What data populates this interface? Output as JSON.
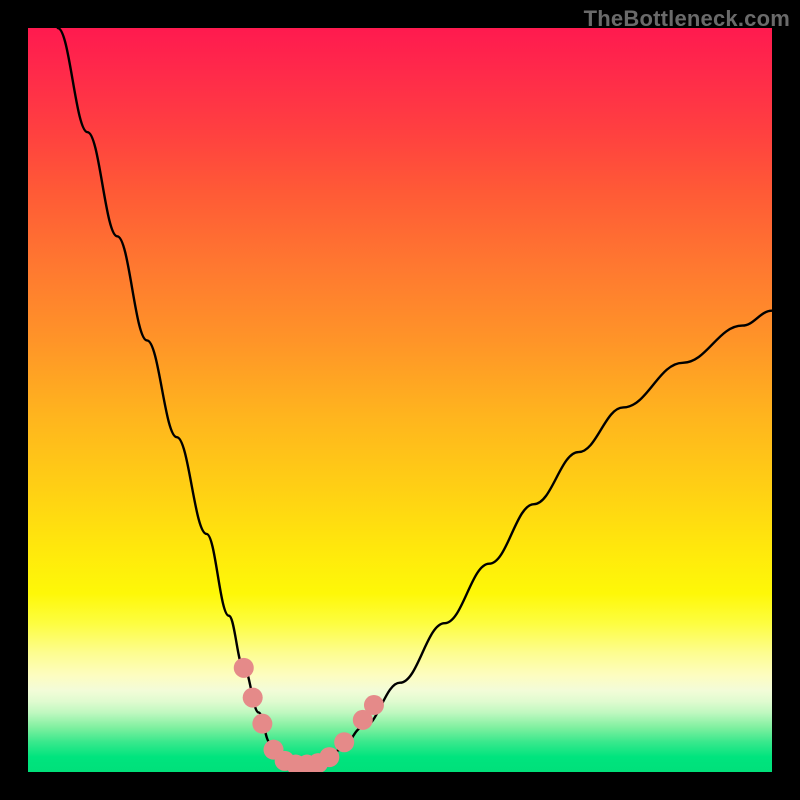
{
  "watermark": "TheBottleneck.com",
  "chart_data": {
    "type": "line",
    "title": "",
    "xlabel": "",
    "ylabel": "",
    "xlim": [
      0,
      100
    ],
    "ylim": [
      0,
      100
    ],
    "grid": false,
    "legend": false,
    "series": [
      {
        "name": "bottleneck-curve",
        "color": "#000000",
        "x": [
          4,
          8,
          12,
          16,
          20,
          24,
          27,
          29,
          31,
          32.5,
          34,
          36,
          38,
          40,
          42,
          45,
          50,
          56,
          62,
          68,
          74,
          80,
          88,
          96,
          100
        ],
        "y": [
          100,
          86,
          72,
          58,
          45,
          32,
          21,
          14,
          8,
          4,
          2,
          1,
          1,
          1.5,
          3,
          6,
          12,
          20,
          28,
          36,
          43,
          49,
          55,
          60,
          62
        ]
      }
    ],
    "markers": {
      "color": "#e58a89",
      "points": [
        {
          "x": 29.0,
          "y": 14.0
        },
        {
          "x": 30.2,
          "y": 10.0
        },
        {
          "x": 31.5,
          "y": 6.5
        },
        {
          "x": 33.0,
          "y": 3.0
        },
        {
          "x": 34.5,
          "y": 1.5
        },
        {
          "x": 36.0,
          "y": 1.0
        },
        {
          "x": 37.5,
          "y": 1.0
        },
        {
          "x": 39.0,
          "y": 1.2
        },
        {
          "x": 40.5,
          "y": 2.0
        },
        {
          "x": 42.5,
          "y": 4.0
        },
        {
          "x": 45.0,
          "y": 7.0
        },
        {
          "x": 46.5,
          "y": 9.0
        }
      ]
    },
    "background_gradient": {
      "top": "#ff1a4f",
      "mid": "#ffe80c",
      "bottom": "#00e07a"
    }
  }
}
